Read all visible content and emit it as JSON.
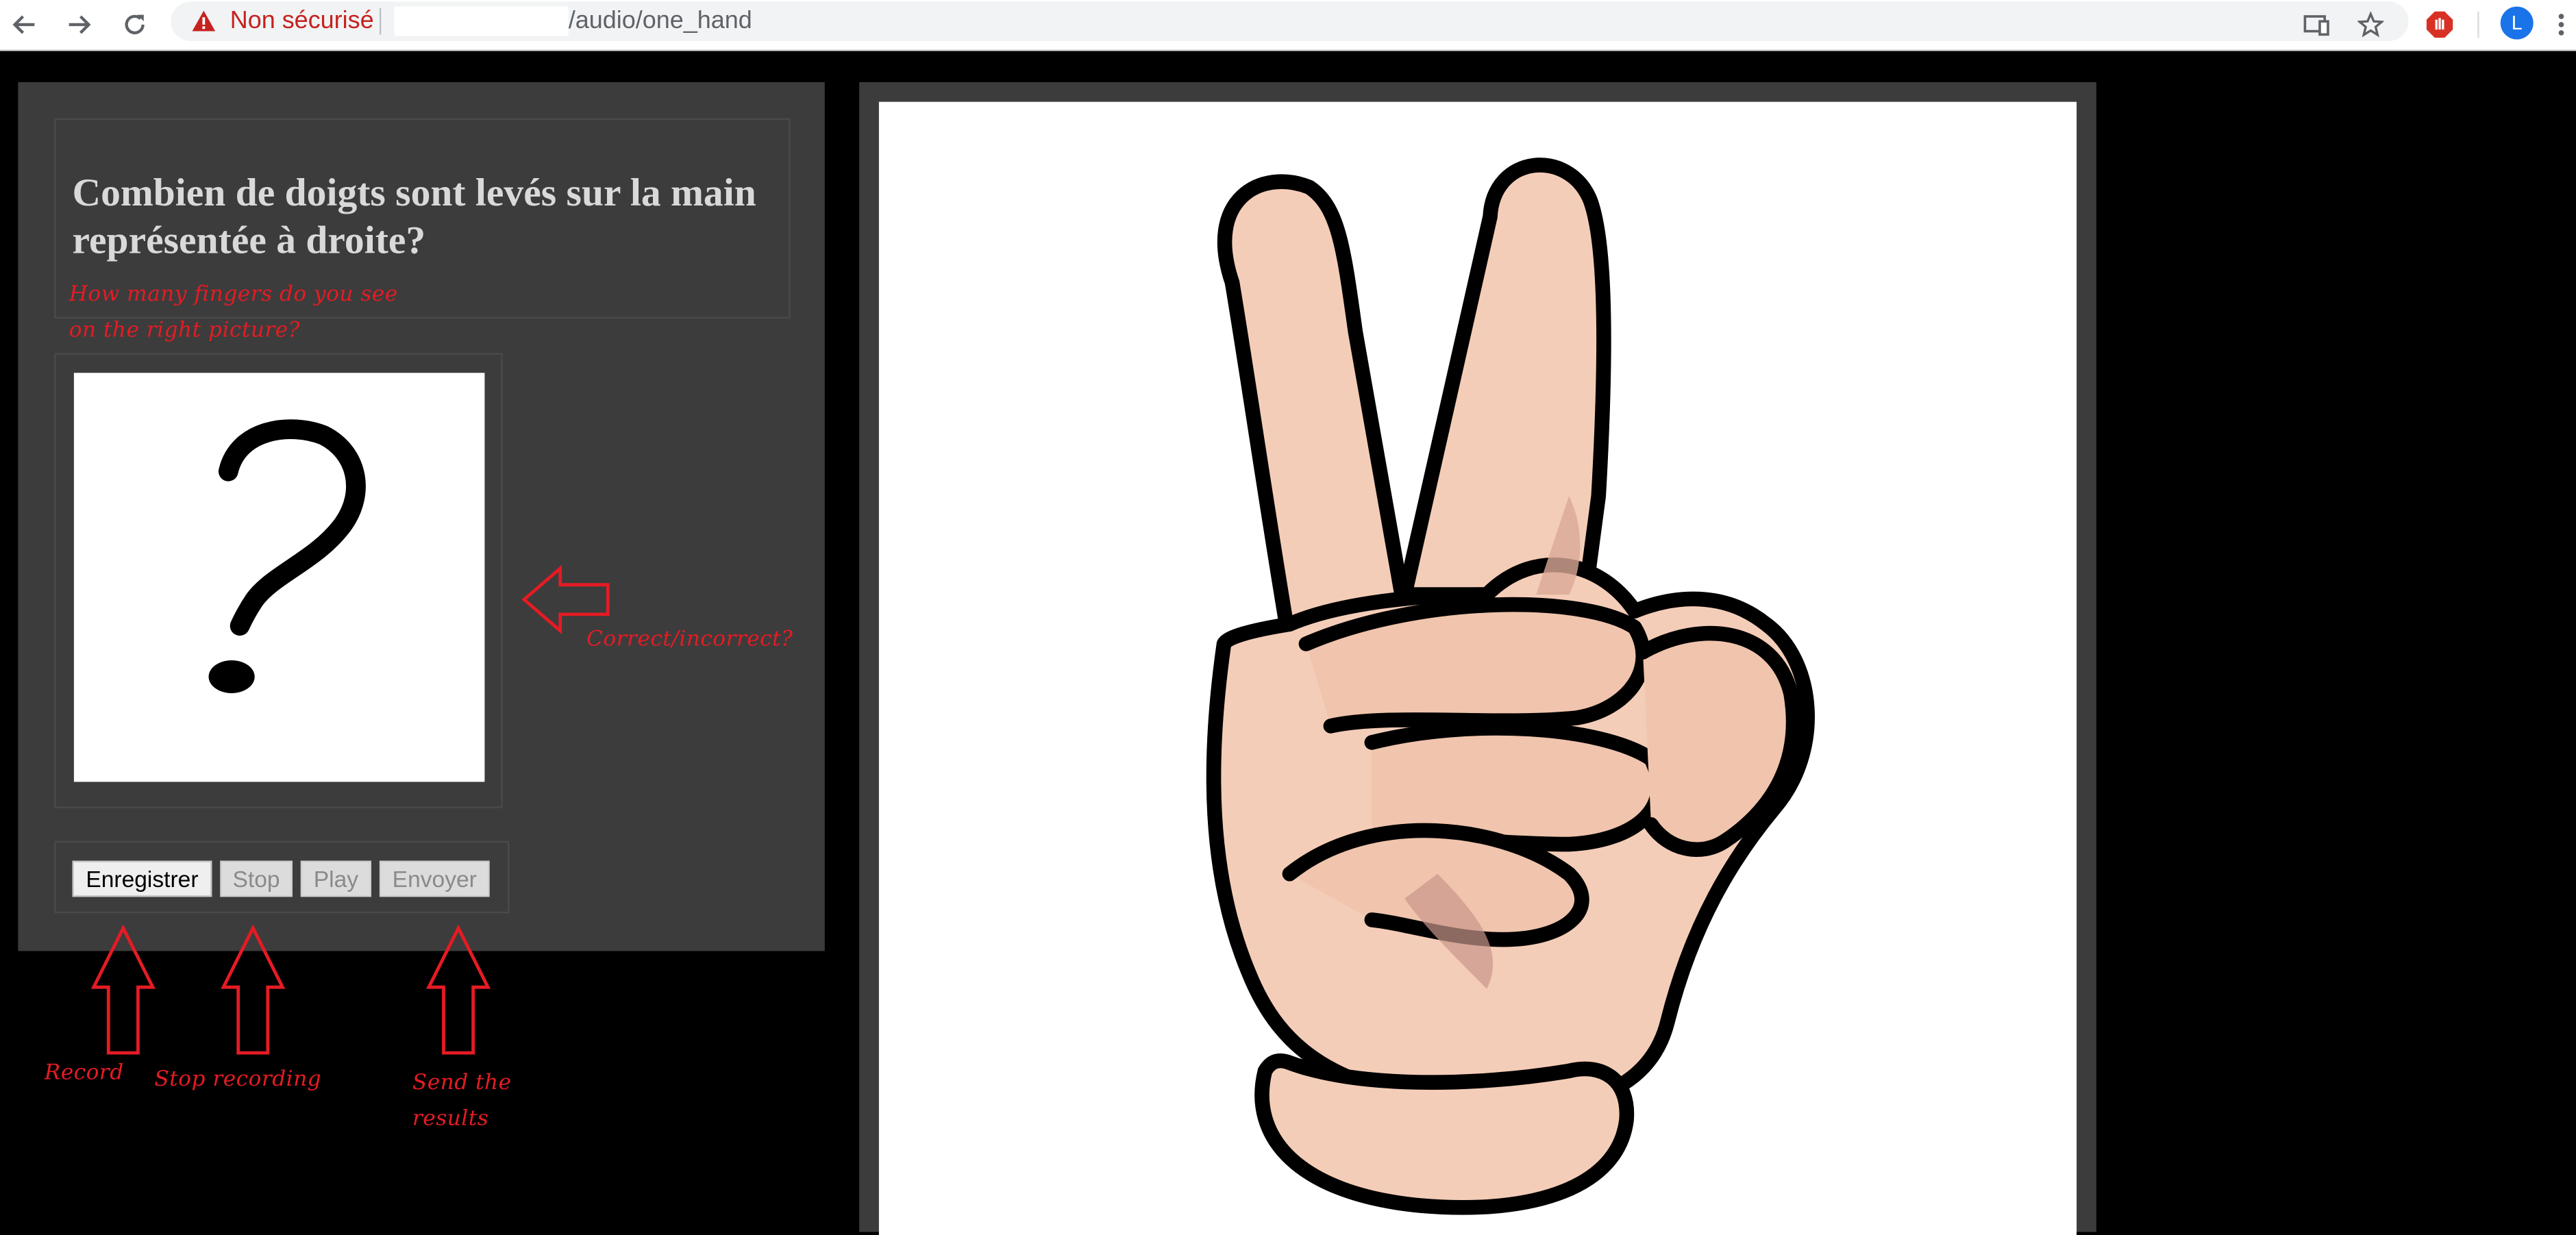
{
  "browser": {
    "security_label": "Non sécurisé",
    "url_path": "/audio/one_hand",
    "profile_initial": "L",
    "icons": [
      "back-icon",
      "forward-icon",
      "reload-icon",
      "warning-icon",
      "cast-icon",
      "star-icon",
      "extension-stop-icon",
      "kebab-menu-icon"
    ]
  },
  "question": {
    "title": "Combien de doigts sont levés sur la main représentée à droite?"
  },
  "buttons": {
    "record": "Enregistrer",
    "stop": "Stop",
    "play": "Play",
    "send": "Envoyer"
  },
  "annotations": {
    "question_en_line1": "How many fingers do you see",
    "question_en_line2": "on the right picture?",
    "correct": "Correct/incorrect?",
    "record": "Record",
    "stop": "Stop recording",
    "send_line1": "Send the",
    "send_line2": "results"
  },
  "colors": {
    "annotation": "#e51b24",
    "panel": "#3c3c3c",
    "page_bg": "#000000",
    "title_text": "#d9d9d9"
  }
}
